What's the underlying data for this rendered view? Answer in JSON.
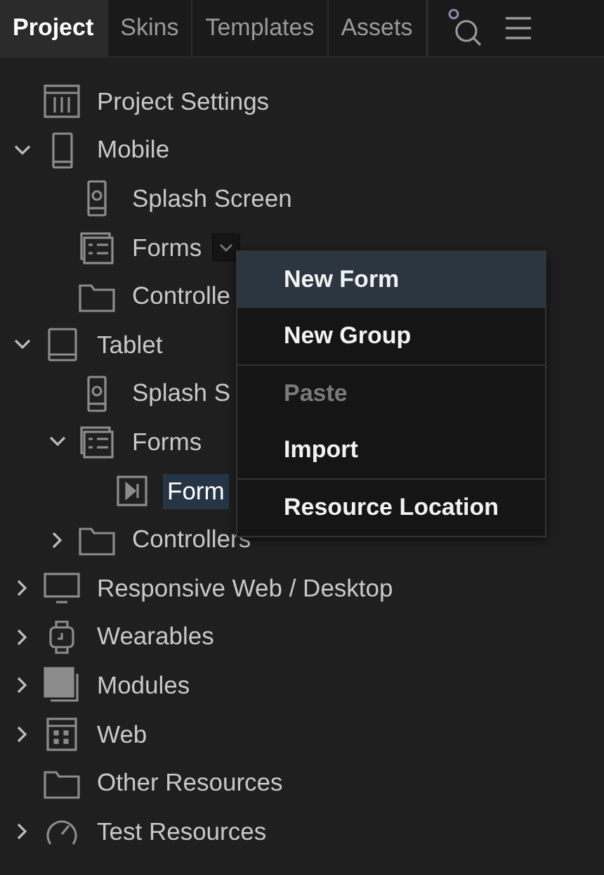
{
  "tabs": [
    {
      "label": "Project",
      "selected": true
    },
    {
      "label": "Skins",
      "selected": false
    },
    {
      "label": "Templates",
      "selected": false
    },
    {
      "label": "Assets",
      "selected": false
    }
  ],
  "tree": [
    {
      "label": "Project Settings",
      "kind": "settings",
      "selected": false
    },
    {
      "label": "Mobile",
      "kind": "phone",
      "expanded": true,
      "selected": false,
      "children": [
        {
          "label": "Splash Screen",
          "kind": "splash",
          "selected": false
        },
        {
          "label": "Forms",
          "kind": "forms",
          "selected": false,
          "menu_button": true
        },
        {
          "label": "Controlle",
          "kind": "folder",
          "selected": false
        }
      ]
    },
    {
      "label": "Tablet",
      "kind": "tablet",
      "expanded": true,
      "selected": false,
      "children": [
        {
          "label": "Splash S",
          "kind": "splash",
          "selected": false
        },
        {
          "label": "Forms",
          "kind": "forms",
          "expanded": true,
          "selected": false,
          "children": [
            {
              "label": "Form",
              "kind": "form",
              "selected": true
            }
          ]
        },
        {
          "label": "Controllers",
          "kind": "folder",
          "expanded": false,
          "selected": false
        }
      ]
    },
    {
      "label": "Responsive Web / Desktop",
      "kind": "monitor",
      "expanded": false,
      "selected": false
    },
    {
      "label": "Wearables",
      "kind": "watch",
      "expanded": false,
      "selected": false
    },
    {
      "label": "Modules",
      "kind": "module",
      "expanded": false,
      "selected": false
    },
    {
      "label": "Web",
      "kind": "web",
      "expanded": false,
      "selected": false
    },
    {
      "label": "Other Resources",
      "kind": "folder",
      "selected": false
    },
    {
      "label": "Test Resources",
      "kind": "gauge",
      "expanded": false,
      "selected": false
    }
  ],
  "context_menu": {
    "groups": [
      [
        {
          "label": "New Form",
          "selected": true,
          "disabled": false
        },
        {
          "label": "New Group",
          "selected": false,
          "disabled": false
        }
      ],
      [
        {
          "label": "Paste",
          "selected": false,
          "disabled": true
        },
        {
          "label": "Import",
          "selected": false,
          "disabled": false
        }
      ],
      [
        {
          "label": "Resource Location",
          "selected": false,
          "disabled": false
        }
      ]
    ]
  }
}
